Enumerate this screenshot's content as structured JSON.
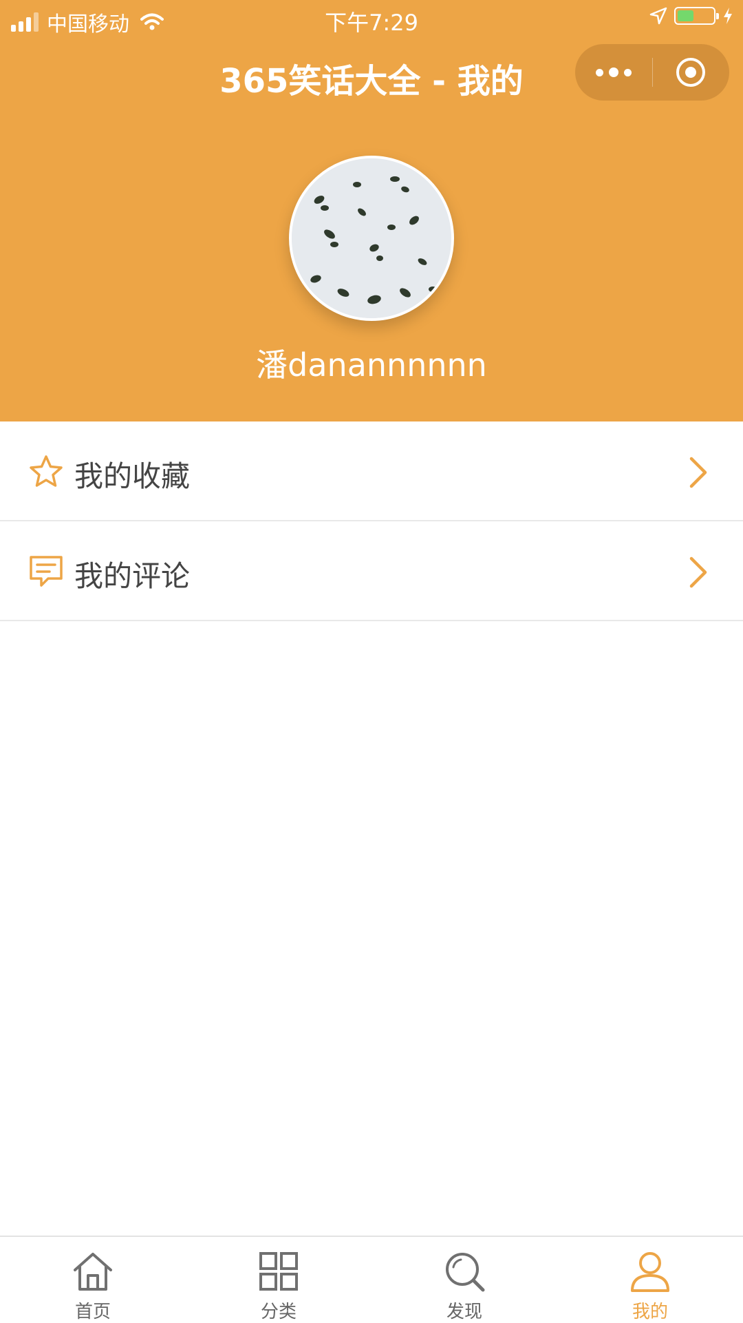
{
  "status_bar": {
    "carrier": "中国移动",
    "time": "下午7:29",
    "battery_level": 0.45
  },
  "navbar": {
    "title": "365笑话大全 - 我的"
  },
  "profile": {
    "username": "潘danannnnnn"
  },
  "menu": {
    "items": [
      {
        "label": "我的收藏",
        "icon": "star-icon"
      },
      {
        "label": "我的评论",
        "icon": "comment-icon"
      }
    ]
  },
  "tabbar": {
    "tabs": [
      {
        "label": "首页",
        "icon": "home-icon"
      },
      {
        "label": "分类",
        "icon": "grid-icon"
      },
      {
        "label": "发现",
        "icon": "search-icon"
      },
      {
        "label": "我的",
        "icon": "user-icon"
      }
    ],
    "active_index": 3
  },
  "colors": {
    "accent": "#EDA546",
    "text": "#444444",
    "inactive": "#666666"
  }
}
